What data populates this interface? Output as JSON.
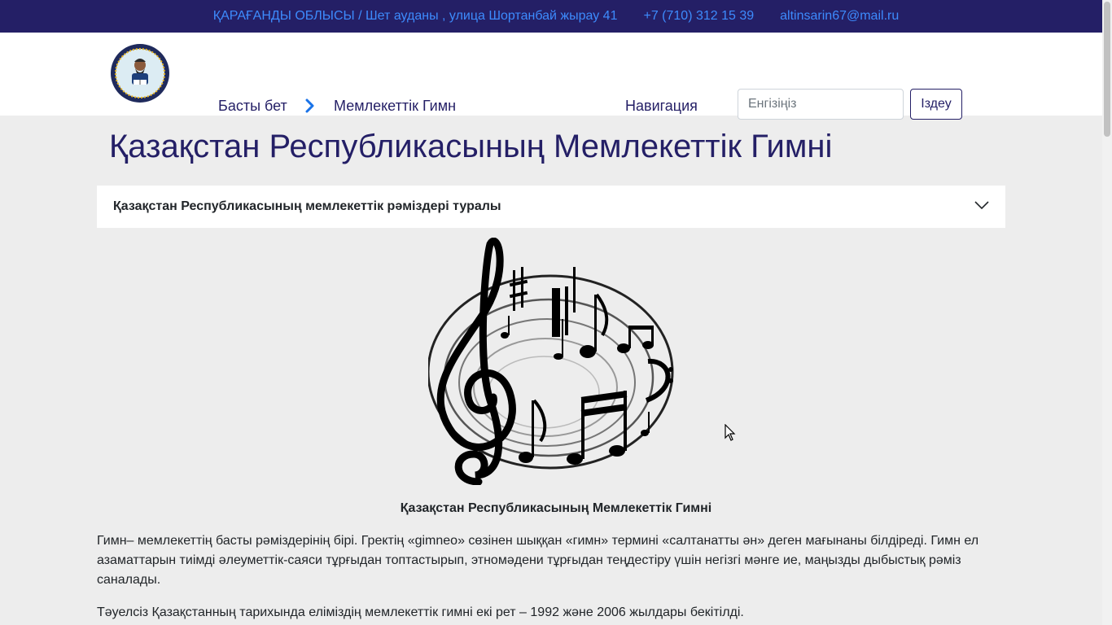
{
  "topbar": {
    "address": "ҚАРАҒАНДЫ ОБЛЫСЫ / Шет ауданы , улица Шортанбай жырау 41",
    "phone": "+7 (710) 312 15 39",
    "email": "altinsarin67@mail.ru"
  },
  "header": {
    "breadcrumb_home": "Басты бет",
    "breadcrumb_current": "Мемлекеттік Гимн",
    "nav_label": "Навигация",
    "search_placeholder": "Енгізіңіз",
    "search_button": "Іздеу"
  },
  "main": {
    "title": "Қазақстан Республикасының Мемлекеттік Гимні",
    "accordion_label": "Қазақстан Республикасының мемлекеттік рәміздері туралы",
    "image_caption": "Қазақстан Республикасының Мемлекеттік Гимні",
    "paragraph_1": "Гимн– мемлекеттің басты рәміздерінің бірі. Гректің «gimneo» сөзінен шыққан «гимн» термині «салтанатты ән» деген мағынаны білдіреді. Гимн ел азаматтарын тиімді әлеуметтік-саяси тұрғыдан топтастырып, этномәдени тұрғыдан теңдестіру үшін негізгі мәнге ие, маңызды дыбыстық рәміз саналады.",
    "paragraph_2": "Тәуелсіз Қазақстанның тарихында еліміздің мемлекеттік гимні екі рет – 1992 және 2006 жылдары бекітілді."
  },
  "colors": {
    "topbar_bg": "#241f66",
    "link": "#3d8bfd",
    "brand": "#241f66",
    "page_bg": "#ededed"
  },
  "icons": [
    "school-logo-icon",
    "chevron-right-icon",
    "chevron-down-icon",
    "music-notes-illustration",
    "mouse-cursor-icon"
  ]
}
